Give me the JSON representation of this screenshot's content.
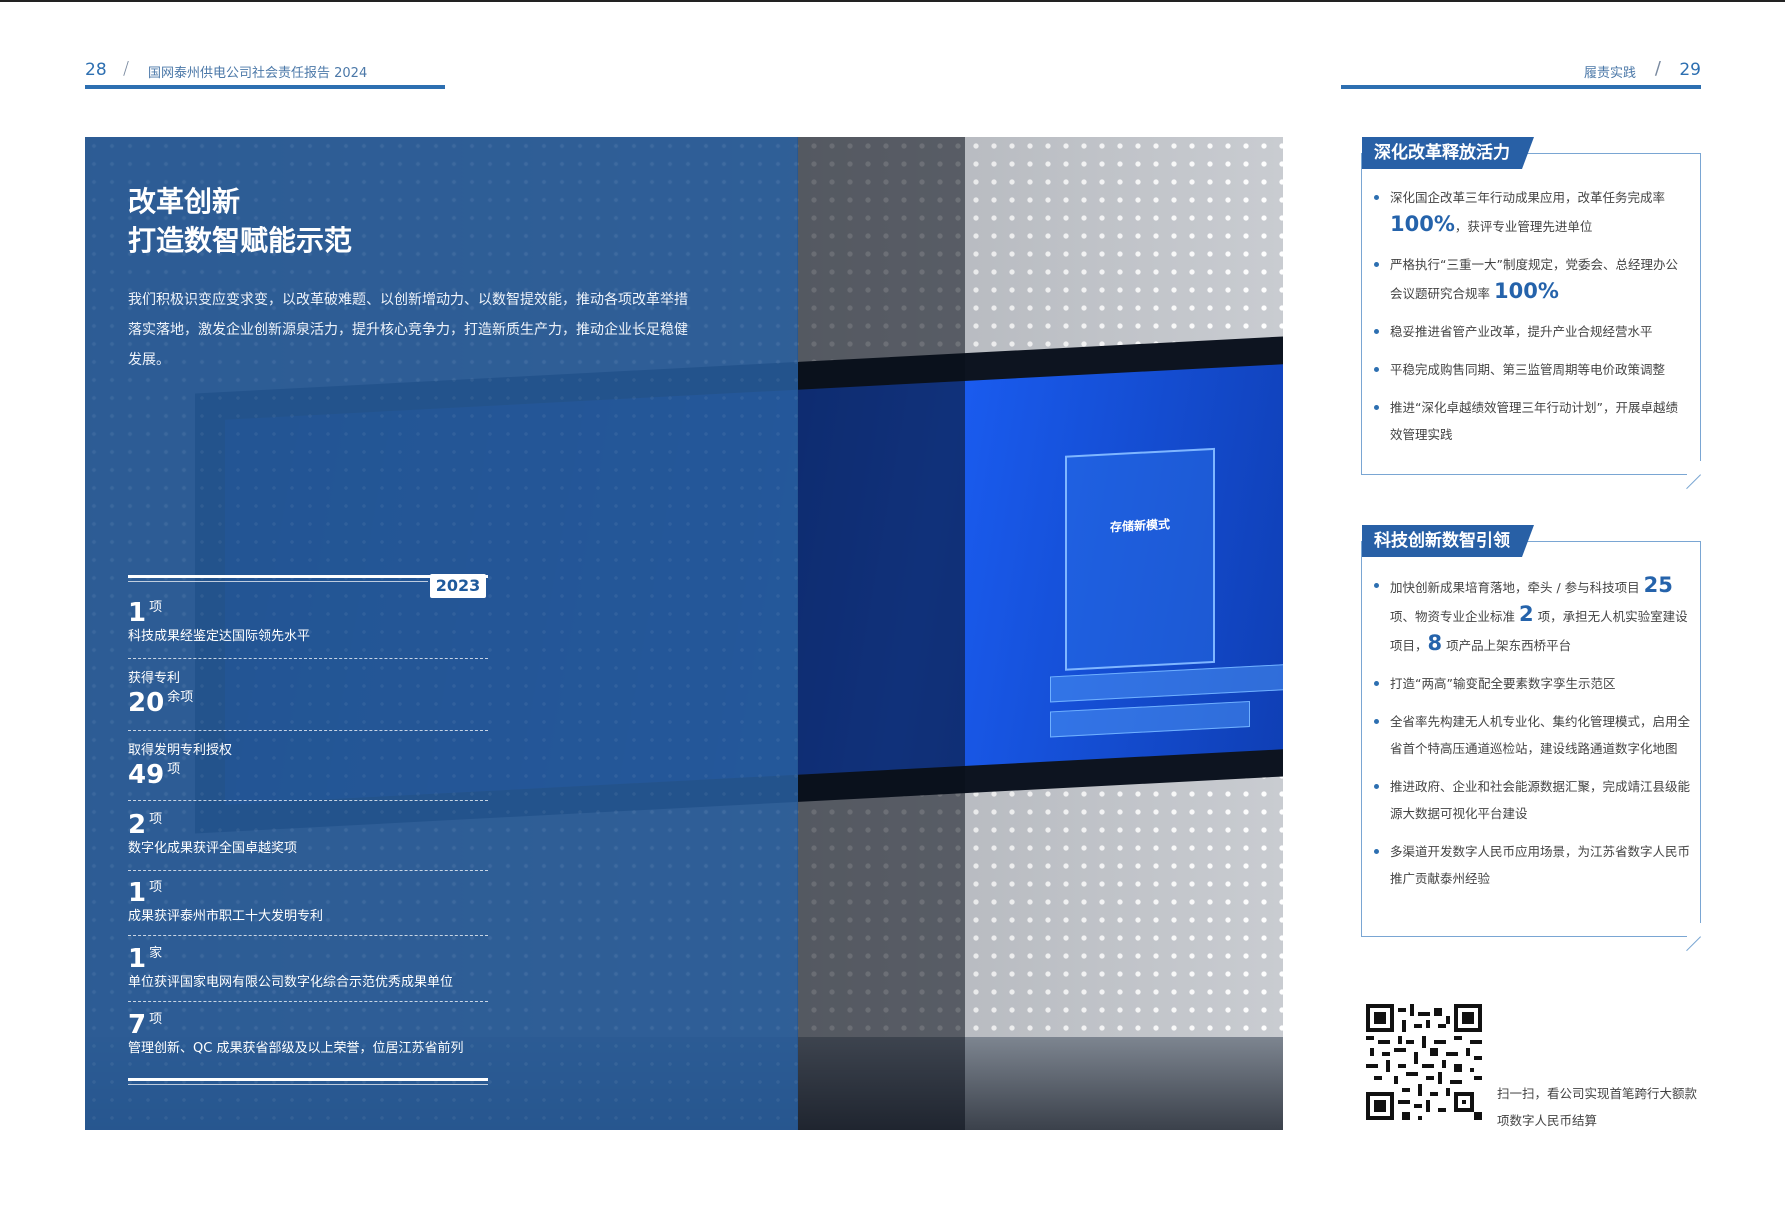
{
  "header_left": {
    "page_number": "28",
    "report_title": "国网泰州供电公司社会责任报告 2024"
  },
  "header_right": {
    "section": "履责实践",
    "page_number": "29"
  },
  "main": {
    "headline_line1": "改革创新",
    "headline_line2": "打造数智赋能示范",
    "intro": "我们积极识变应变求变，以改革破难题、以创新增动力、以数智提效能，推动各项改革举措落实落地，激发企业创新源泉活力，提升核心竞争力，打造新质生产力，推动企业长足稳健发展。",
    "year": "2023"
  },
  "stats": [
    {
      "pre": "",
      "num": "1",
      "unit": "项",
      "label": "科技成果经鉴定达国际领先水平"
    },
    {
      "pre": "获得专利",
      "num": "20",
      "unit": "余项",
      "label": ""
    },
    {
      "pre": "取得发明专利授权",
      "num": "49",
      "unit": "项",
      "label": ""
    },
    {
      "pre": "",
      "num": "2",
      "unit": "项",
      "label": "数字化成果获评全国卓越奖项"
    },
    {
      "pre": "",
      "num": "1",
      "unit": "项",
      "label": "成果获评泰州市职工十大发明专利"
    },
    {
      "pre": "",
      "num": "1",
      "unit": "家",
      "label": "单位获评国家电网有限公司数字化综合示范优秀成果单位"
    },
    {
      "pre": "",
      "num": "7",
      "unit": "项",
      "label": "管理创新、QC 成果获省部级及以上荣誉，位居江苏省前列"
    }
  ],
  "photo": {
    "screen_card_title": "存储新模式",
    "colors": {
      "overlay": "#265894",
      "accent": "#2d6fb1",
      "screen": "#1a5cf0"
    }
  },
  "reform_box": {
    "title": "深化改革释放活力",
    "items": [
      {
        "a": "深化国企改革三年行动成果应用，改革任务完成率 ",
        "b": "100%",
        "c": "，获评专业管理先进单位"
      },
      {
        "a": "严格执行“三重一大”制度规定，党委会、总经理办公会议题研究合规率 ",
        "b": "100%",
        "c": ""
      },
      {
        "a": "稳妥推进省管产业改革，提升产业合规经营水平",
        "b": "",
        "c": ""
      },
      {
        "a": "平稳完成购售同期、第三监管周期等电价政策调整",
        "b": "",
        "c": ""
      },
      {
        "a": "推进“深化卓越绩效管理三年行动计划”，开展卓越绩效管理实践",
        "b": "",
        "c": ""
      }
    ]
  },
  "tech_box": {
    "title": "科技创新数智引领",
    "item1": {
      "a": "加快创新成果培育落地，牵头 / 参与科技项目 ",
      "n1": "25",
      "b": " 项、物资专业企业标准 ",
      "n2": "2",
      "c": " 项，承担无人机实验室建设项目，",
      "n3": "8",
      "d": " 项产品上架东西桥平台"
    },
    "items": [
      "打造“两高”输变配全要素数字孪生示范区",
      "全省率先构建无人机专业化、集约化管理模式，启用全省首个特高压通道巡检站，建设线路通道数字化地图",
      "推进政府、企业和社会能源数据汇聚，完成靖江县级能源大数据可视化平台建设",
      "多渠道开发数字人民币应用场景，为江苏省数字人民币推广贡献泰州经验"
    ]
  },
  "qr": {
    "caption": "扫一扫，看公司实现首笔跨行大额款项数字人民币结算"
  }
}
